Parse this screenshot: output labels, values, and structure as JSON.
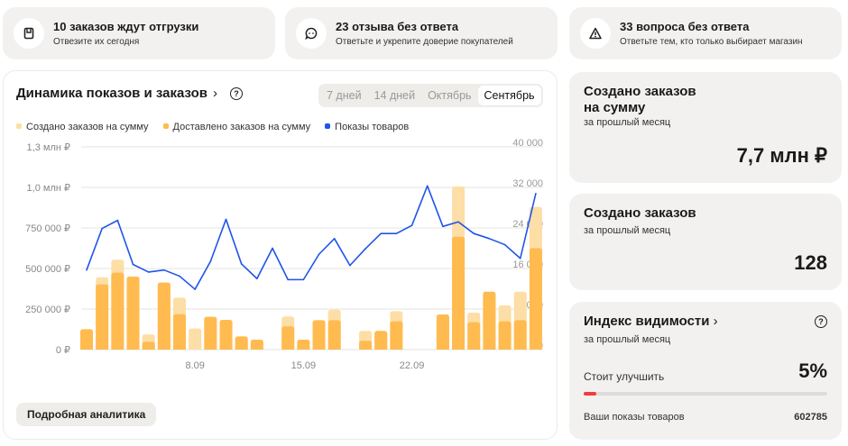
{
  "alerts": [
    {
      "title": "10 заказов ждут отгрузки",
      "subtitle": "Отвезите их сегодня",
      "icon": "package-icon"
    },
    {
      "title": "23 отзыва без ответа",
      "subtitle": "Ответьте и укрепите доверие покупателей",
      "icon": "chat-icon"
    },
    {
      "title": "33 вопроса без ответа",
      "subtitle": "Ответьте тем, кто только выбирает магазин",
      "icon": "warning-icon"
    }
  ],
  "chart_panel": {
    "title": "Динамика показов и заказов",
    "tabs": [
      "7 дней",
      "14 дней",
      "Октябрь",
      "Сентябрь"
    ],
    "active_tab": "Сентябрь",
    "more_button": "Подробная аналитика"
  },
  "chart_data": {
    "type": "bar",
    "legend": [
      "Создано заказов на сумму",
      "Доставлено заказов на сумму",
      "Показы товаров"
    ],
    "colors": {
      "created": "#fddea6",
      "delivered": "#ffbb4f",
      "views": "#1f55e8"
    },
    "left_ticks": [
      "0 ₽",
      "250 000 ₽",
      "500 000 ₽",
      "750 000 ₽",
      "1,0 млн ₽",
      "1,3 млн ₽"
    ],
    "left_tick_values": [
      0,
      250000,
      500000,
      750000,
      1000000,
      1250000
    ],
    "right_ticks": [
      "0",
      "8 000",
      "16 000",
      "24 000",
      "32 000",
      "40 000"
    ],
    "right_tick_values": [
      0,
      8000,
      16000,
      24000,
      32000,
      40000
    ],
    "x_ticks": [
      {
        "day": 8,
        "label": "8.09"
      },
      {
        "day": 15,
        "label": "15.09"
      },
      {
        "day": 22,
        "label": "22.09"
      }
    ],
    "days": [
      1,
      2,
      3,
      4,
      5,
      6,
      7,
      8,
      9,
      10,
      11,
      12,
      13,
      14,
      15,
      16,
      17,
      18,
      19,
      20,
      21,
      22,
      23,
      24,
      25,
      26,
      27,
      28,
      29,
      30
    ],
    "series": [
      {
        "name": "Создано заказов на сумму",
        "values": [
          126000,
          446000,
          554000,
          450000,
          94000,
          413000,
          320000,
          130000,
          202000,
          183000,
          81000,
          61000,
          0,
          204000,
          61000,
          181000,
          246000,
          0,
          115000,
          115000,
          237000,
          0,
          0,
          217000,
          1006000,
          228000,
          357000,
          272000,
          357000,
          880000
        ]
      },
      {
        "name": "Доставлено заказов на сумму",
        "values": [
          126000,
          402000,
          474000,
          450000,
          48000,
          413000,
          218000,
          0,
          202000,
          183000,
          81000,
          61000,
          0,
          143000,
          61000,
          181000,
          181000,
          0,
          54000,
          115000,
          174000,
          0,
          0,
          217000,
          696000,
          169000,
          357000,
          174000,
          181000,
          626000
        ]
      },
      {
        "name": "Показы товаров",
        "axis": "right",
        "values": [
          15700,
          23900,
          25500,
          16800,
          15300,
          15700,
          14500,
          11900,
          17400,
          25700,
          16900,
          14000,
          20000,
          13800,
          13800,
          18800,
          21900,
          16600,
          19900,
          22900,
          22900,
          24500,
          32300,
          24300,
          25200,
          22900,
          21900,
          20700,
          18000,
          30800
        ]
      }
    ],
    "grid": true
  },
  "summary": {
    "created_sum": {
      "title_line1": "Создано заказов",
      "title_line2": "на сумму",
      "subtitle": "за прошлый месяц",
      "value": "7,7 млн ₽"
    },
    "created_count": {
      "title": "Создано заказов",
      "subtitle": "за прошлый месяц",
      "value": "128"
    },
    "visibility": {
      "title": "Индекс видимости",
      "subtitle": "за прошлый месяц",
      "status": "Стоит улучшить",
      "percent_label": "5%",
      "progress": 5,
      "views_label": "Ваши показы товаров",
      "views_value": "602785",
      "bar_color": "#f23b3b"
    }
  }
}
